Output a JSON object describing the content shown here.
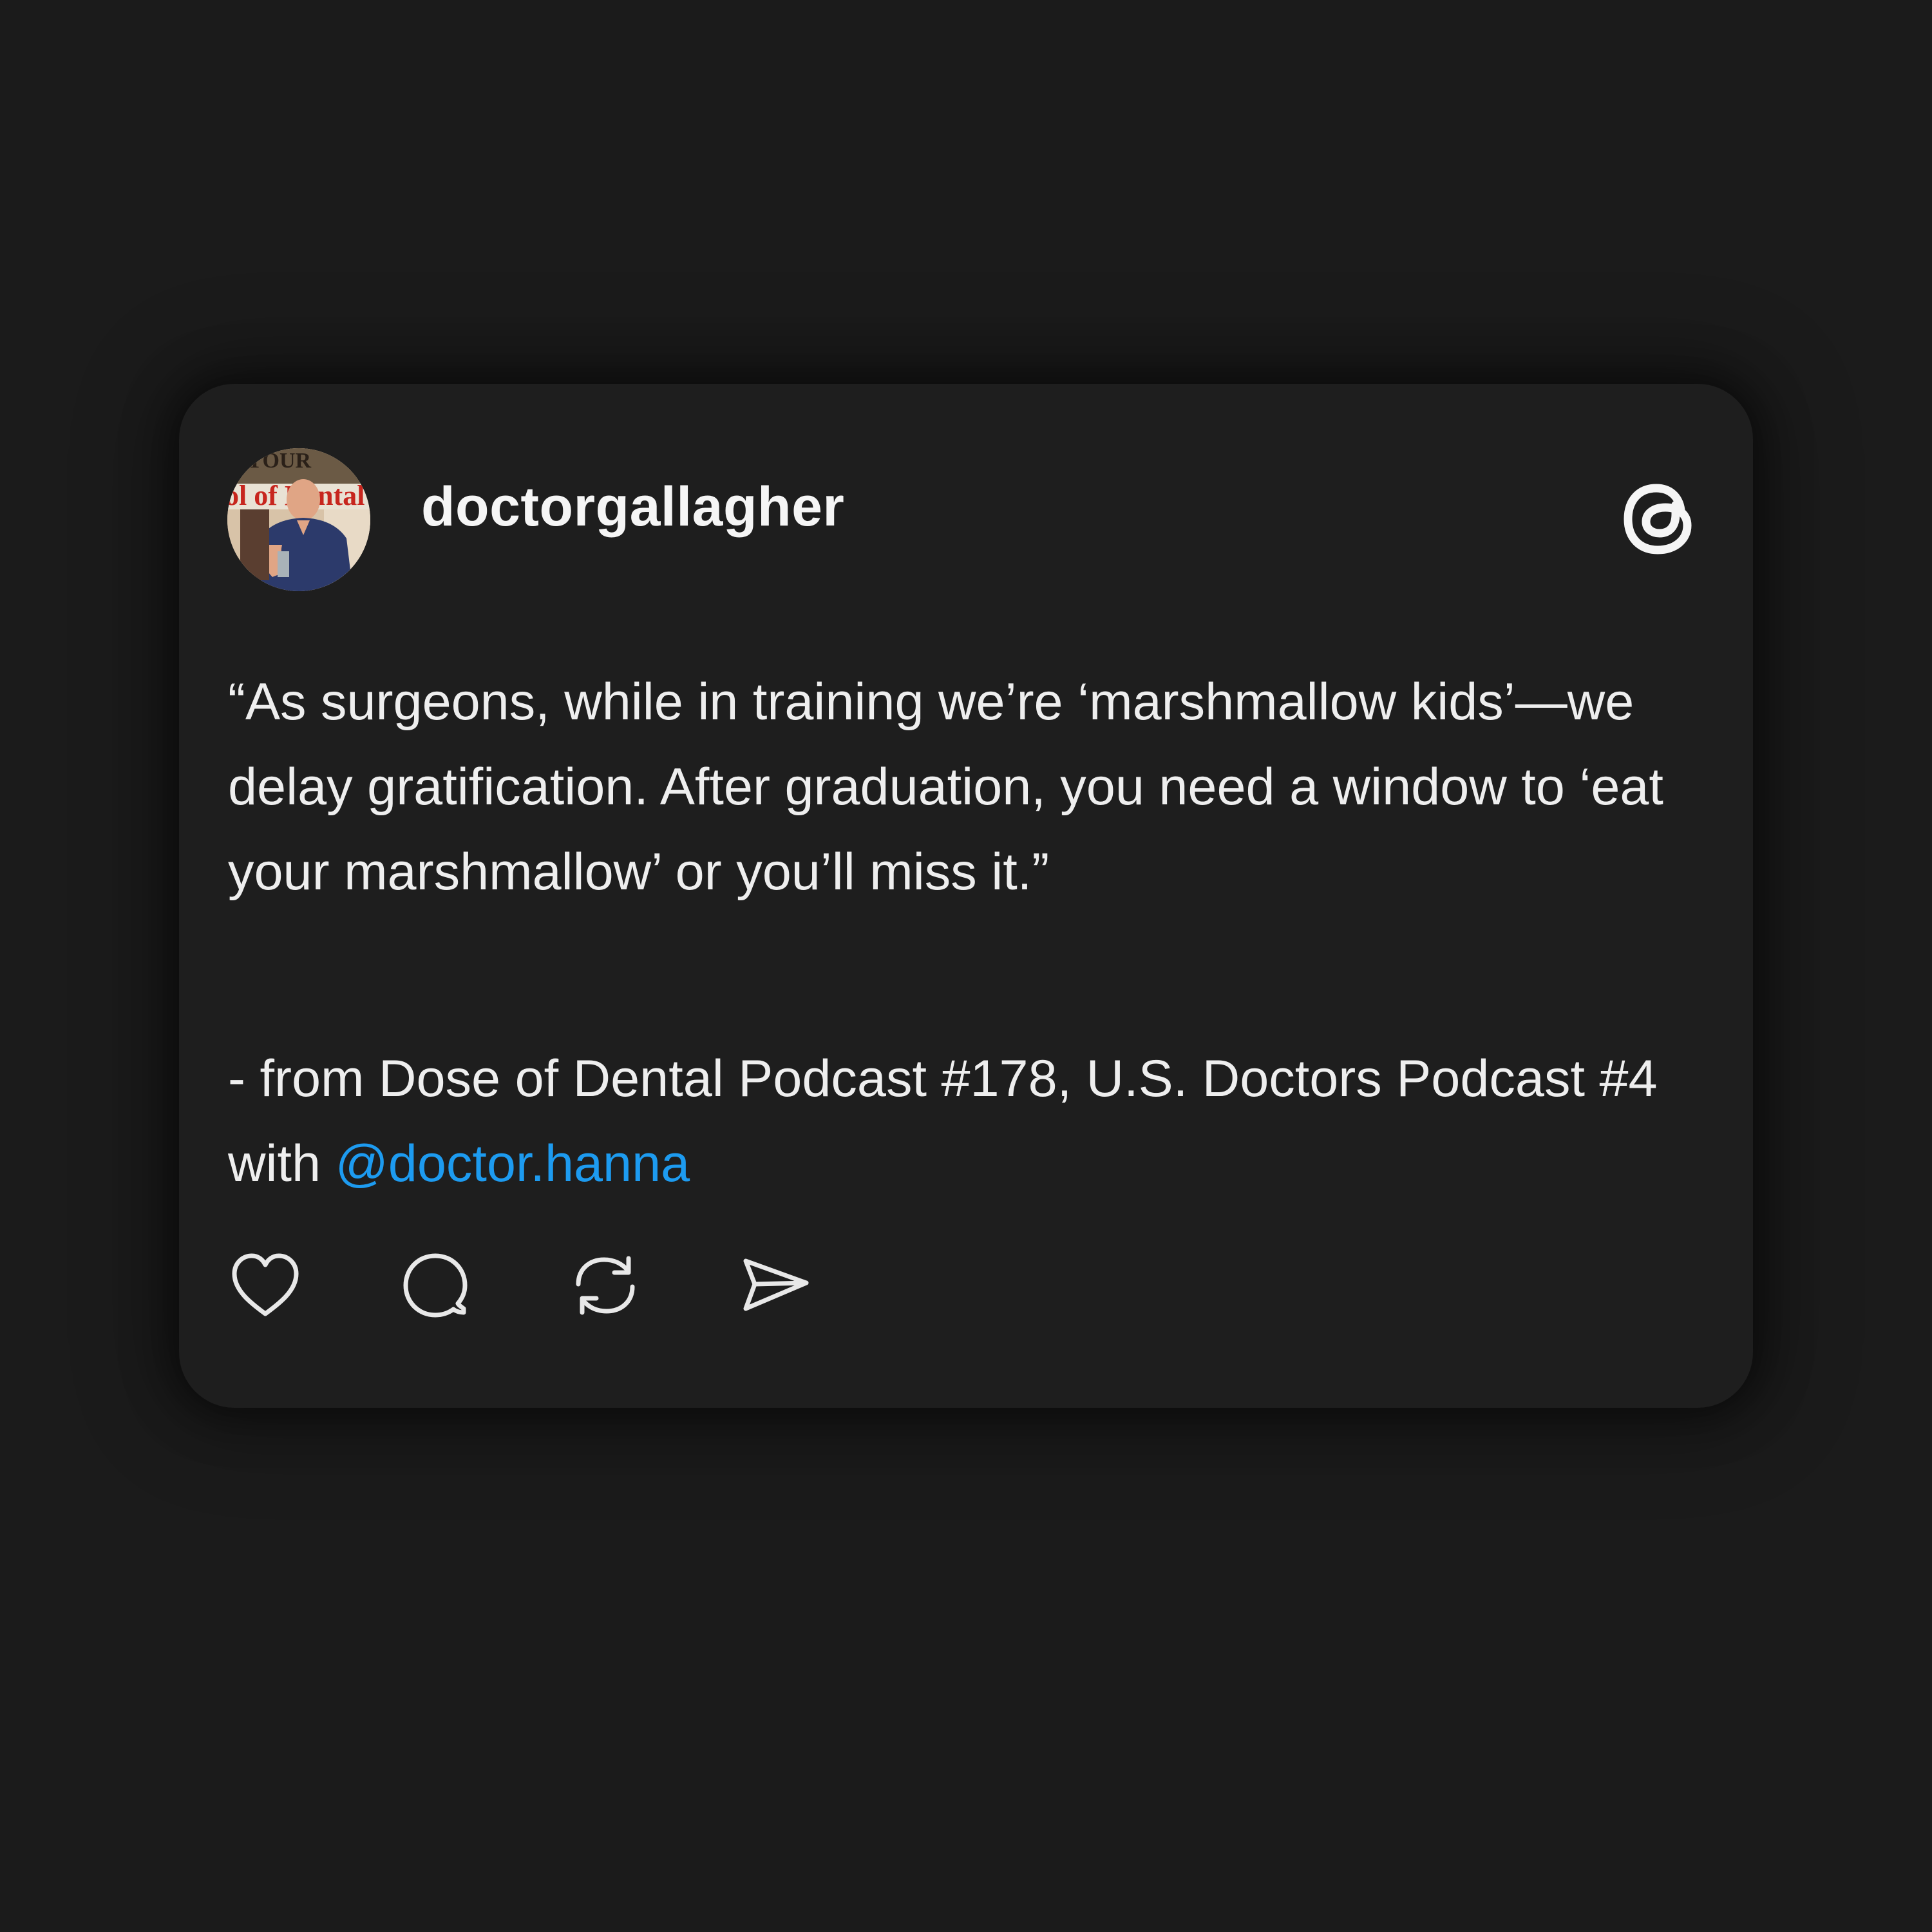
{
  "post": {
    "username": "doctorgallagher",
    "quote": "“As surgeons, while in training we’re ‘marshmallow kids’—we delay gratification. After graduation, you need a window to ‘eat your marshmallow’ or you’ll miss it.”",
    "source_prefix": "- from Dose of Dental Podcast #178, U.S. Doctors Podcast #4 with ",
    "mention": "@doctor.hanna",
    "avatar_sign_text": "ol of Dental",
    "avatar_sign_top_text": "YOUR"
  },
  "actions": [
    {
      "name": "like",
      "icon": "heart-icon"
    },
    {
      "name": "reply",
      "icon": "speech-bubble-icon"
    },
    {
      "name": "repost",
      "icon": "repost-icon"
    },
    {
      "name": "share",
      "icon": "send-icon"
    }
  ],
  "colors": {
    "background": "#1b1b1b",
    "card": "#1e1e1e",
    "text": "#eeeeee",
    "mention": "#1d9bf0"
  }
}
